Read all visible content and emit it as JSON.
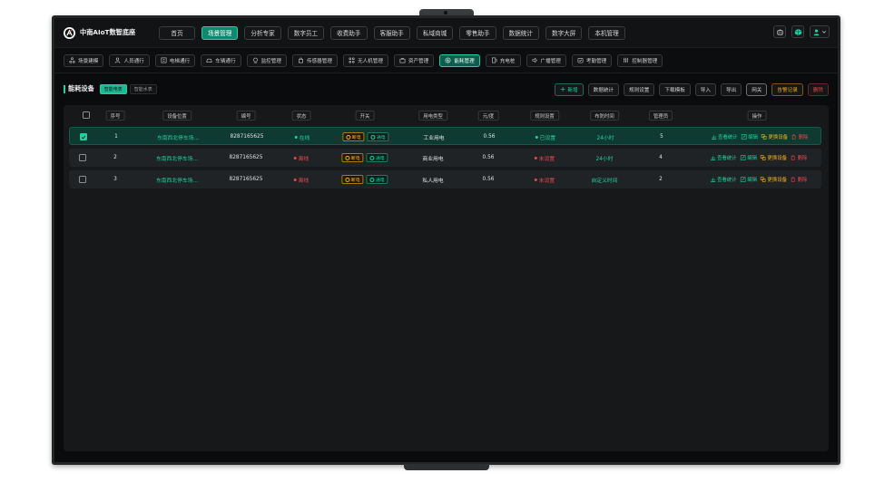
{
  "brand": {
    "name": "中南AIoT数智底座"
  },
  "top_nav": [
    {
      "label": "首页",
      "active": false
    },
    {
      "label": "场景管理",
      "active": true
    },
    {
      "label": "分析专家",
      "active": false
    },
    {
      "label": "数字员工",
      "active": false
    },
    {
      "label": "收费助手",
      "active": false
    },
    {
      "label": "客服助手",
      "active": false
    },
    {
      "label": "私域商城",
      "active": false
    },
    {
      "label": "零售助手",
      "active": false
    },
    {
      "label": "数据统计",
      "active": false
    },
    {
      "label": "数字大屏",
      "active": false
    },
    {
      "label": "本机管理",
      "active": false
    }
  ],
  "top_right_icons": [
    "robot-icon",
    "cube-icon",
    "user-icon",
    "chevron-down-icon"
  ],
  "sub_nav": [
    {
      "label": "场景建模",
      "icon": "nodes-icon",
      "active": false
    },
    {
      "label": "人员通行",
      "icon": "person-icon",
      "active": false
    },
    {
      "label": "电梯通行",
      "icon": "elevator-icon",
      "active": false
    },
    {
      "label": "车辆通行",
      "icon": "car-icon",
      "active": false
    },
    {
      "label": "监控管理",
      "icon": "camera-icon",
      "active": false
    },
    {
      "label": "传感器管理",
      "icon": "sensor-icon",
      "active": false
    },
    {
      "label": "无人机管理",
      "icon": "drone-icon",
      "active": false
    },
    {
      "label": "资产管理",
      "icon": "asset-icon",
      "active": false
    },
    {
      "label": "能耗管理",
      "icon": "energy-icon",
      "active": true
    },
    {
      "label": "充电桩",
      "icon": "charger-icon",
      "active": false
    },
    {
      "label": "广播管理",
      "icon": "speaker-icon",
      "active": false
    },
    {
      "label": "考勤管理",
      "icon": "attendance-icon",
      "active": false
    },
    {
      "label": "控制器管理",
      "icon": "controller-icon",
      "active": false
    }
  ],
  "page": {
    "title": "能耗设备",
    "subtabs": [
      {
        "label": "智能电表",
        "active": true
      },
      {
        "label": "智能水表",
        "active": false
      }
    ],
    "actions": {
      "add": "新增",
      "stats": "数据统计",
      "rules": "规则设置",
      "download_template": "下载模板",
      "import": "导入",
      "export": "导出",
      "gateway": "网关",
      "alarm_log": "告警记录",
      "delete": "删除"
    }
  },
  "table": {
    "columns": [
      "序号",
      "设备位置",
      "编号",
      "状态",
      "开关",
      "用电类型",
      "元/度",
      "规则设置",
      "布防时间",
      "管理员",
      "操作"
    ],
    "rows": [
      {
        "selected": true,
        "index": "1",
        "location": "东南西北停车场...",
        "code": "8287165625",
        "status": "在线",
        "online": true,
        "sw_off": "断电",
        "sw_on": "通电",
        "power_type": "工业用电",
        "price": "0.56",
        "rule": "已设置",
        "rule_set": true,
        "defense": "24小时",
        "admin": "5"
      },
      {
        "selected": false,
        "index": "2",
        "location": "东南西北停车场...",
        "code": "8287165625",
        "status": "离线",
        "online": false,
        "sw_off": "断电",
        "sw_on": "通电",
        "power_type": "商业用电",
        "price": "0.56",
        "rule": "未设置",
        "rule_set": false,
        "defense": "24小时",
        "admin": "4"
      },
      {
        "selected": false,
        "index": "3",
        "location": "东南西北停车场...",
        "code": "8287165625",
        "status": "离线",
        "online": false,
        "sw_off": "断电",
        "sw_on": "通电",
        "power_type": "私人用电",
        "price": "0.56",
        "rule": "未设置",
        "rule_set": false,
        "defense": "自定义时间",
        "admin": "2"
      }
    ],
    "row_actions": {
      "view_stats": "查看统计",
      "edit": "编辑",
      "replace": "更换设备",
      "delete": "删除"
    }
  },
  "colors": {
    "accent": "#1fd1a3",
    "warning": "#f2b01e",
    "danger": "#e5484d",
    "background": "#0a0b0c"
  }
}
